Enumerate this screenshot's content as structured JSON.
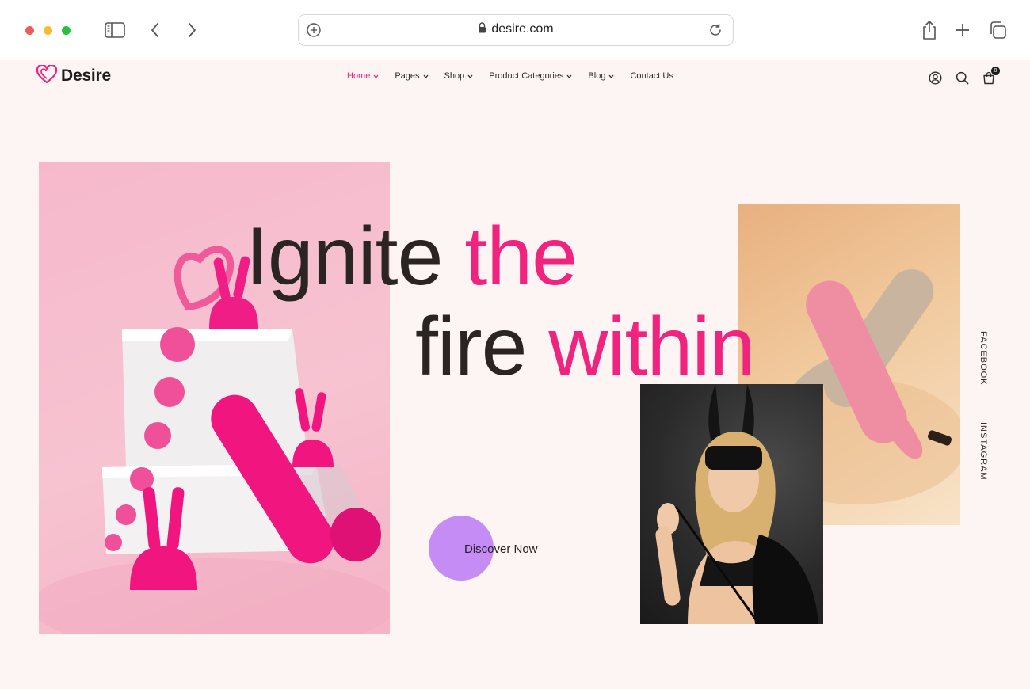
{
  "browser": {
    "url": "desire.com",
    "icons": [
      "sidebar-icon",
      "back-icon",
      "forward-icon",
      "add-icon",
      "lock-icon",
      "reload-icon",
      "share-icon",
      "new-tab-icon",
      "tabs-icon"
    ]
  },
  "site": {
    "brand": "Desire",
    "brand_color": "#f0237e",
    "nav": [
      {
        "label": "Home",
        "active": true
      },
      {
        "label": "Pages"
      },
      {
        "label": "Shop"
      },
      {
        "label": "Product Categories"
      },
      {
        "label": "Blog"
      },
      {
        "label": "Contact Us",
        "no_caret": true
      }
    ],
    "header_icons": [
      "account-icon",
      "search-icon",
      "cart-icon"
    ],
    "cart_count": "0"
  },
  "hero": {
    "line1_dark": "Ignite",
    "line1_pink": "the",
    "line2_dark": "fire",
    "line2_pink": "within",
    "cta": "Discover Now",
    "cta_color": "#c68cf6"
  },
  "social": {
    "facebook": "FACEBOOK",
    "instagram": "INSTAGRAM"
  }
}
